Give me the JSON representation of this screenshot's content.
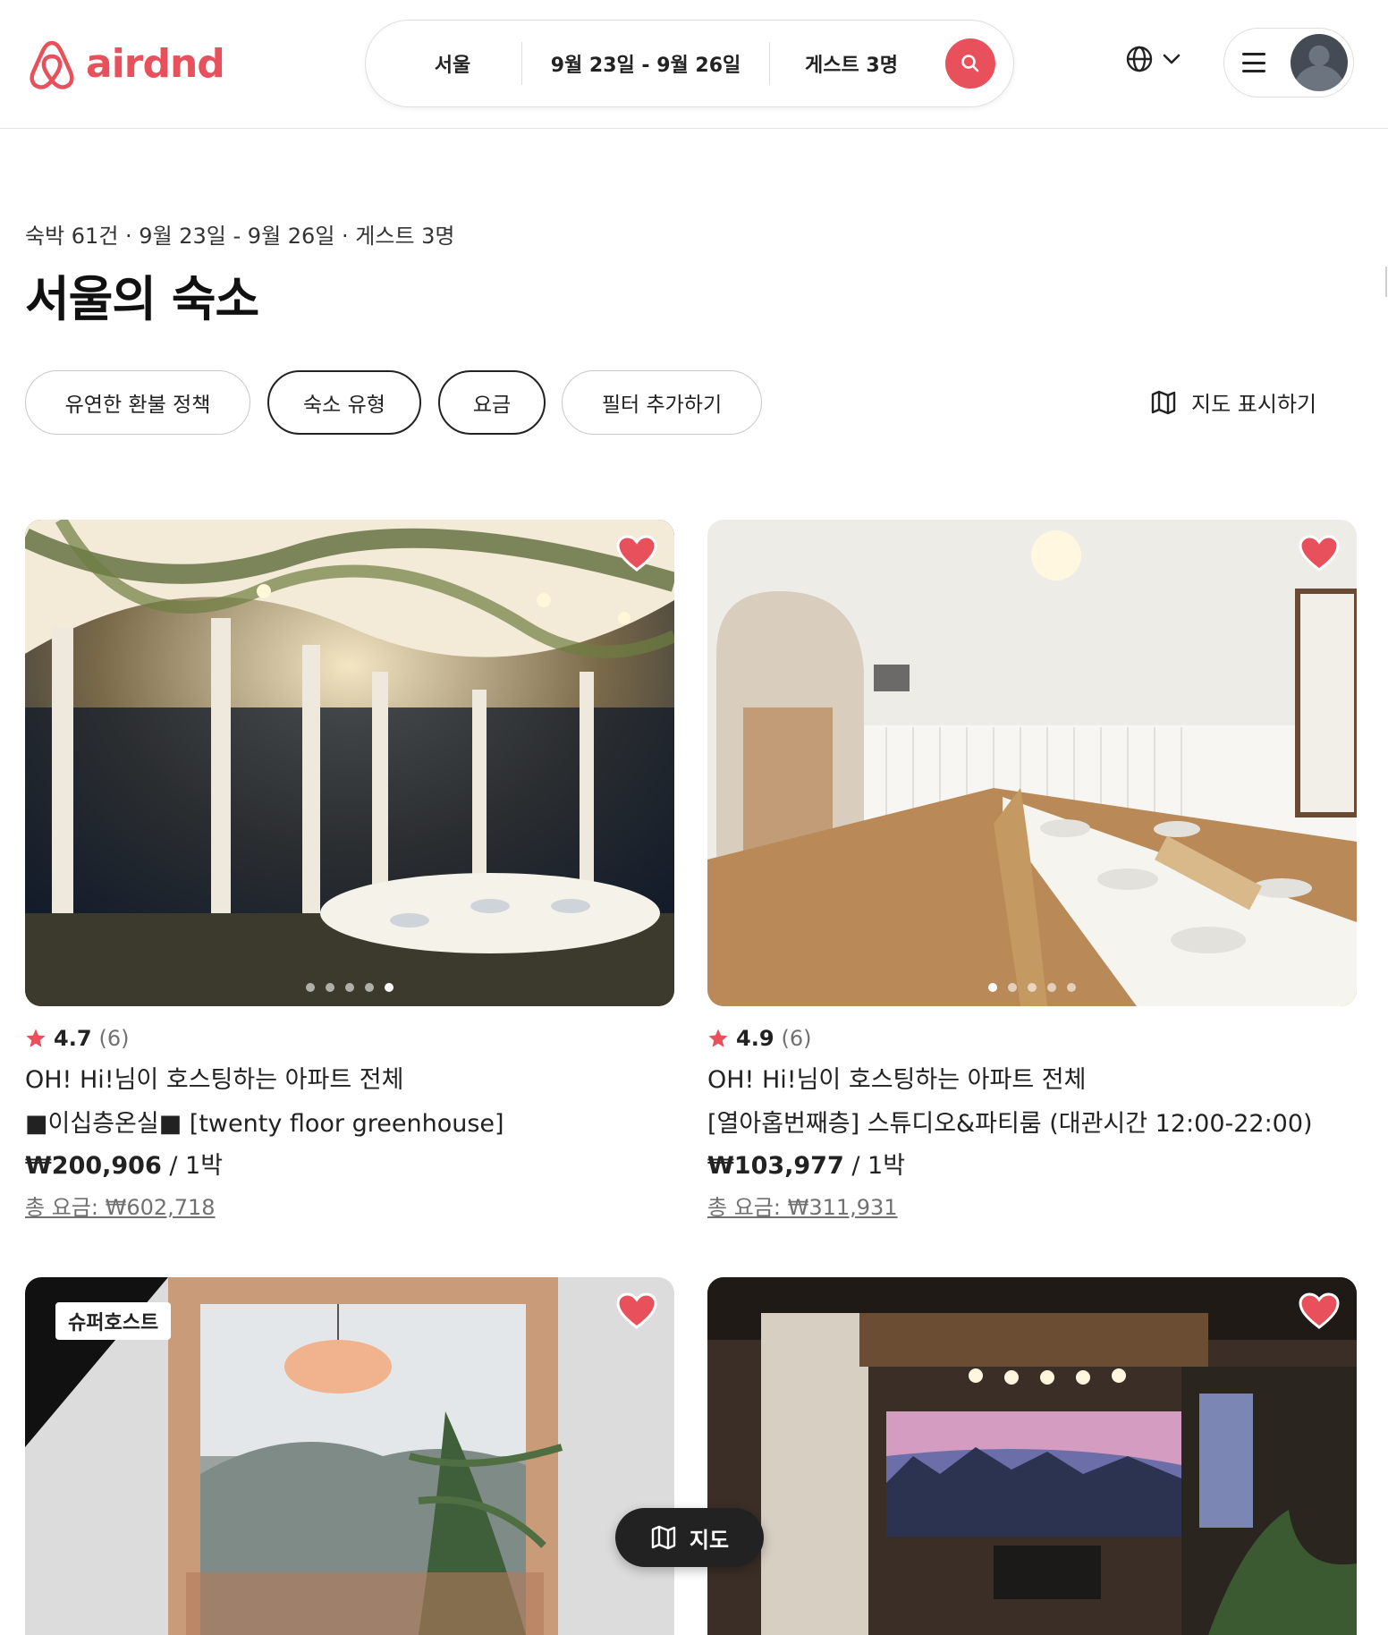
{
  "brand": {
    "name": "airdnd",
    "color": "#e8505b"
  },
  "search": {
    "location": "서울",
    "dates": "9월 23일 - 9월 26일",
    "guests": "게스트 3명",
    "icon": "search-icon"
  },
  "header": {
    "globe_icon": "globe-icon",
    "chevron_icon": "chevron-down-icon",
    "menu_icon": "hamburger-icon"
  },
  "results": {
    "summary": "숙박 61건 · 9월 23일 - 9월 26일 · 게스트 3명",
    "title": "서울의 숙소"
  },
  "filters": {
    "chips": [
      "유연한 환불 정책",
      "숙소 유형",
      "요금",
      "필터 추가하기"
    ],
    "map_toggle": "지도 표시하기"
  },
  "listings": [
    {
      "rating": "4.7",
      "reviews": "(6)",
      "host_line": "OH! Hi!님이 호스팅하는 아파트 전체",
      "name": "■이십층온실■ [twenty floor greenhouse]",
      "price": "₩200,906",
      "per": " / 1박",
      "total": "총 요금: ₩602,718",
      "photo_dots": 5,
      "active_dot": 4
    },
    {
      "rating": "4.9",
      "reviews": "(6)",
      "host_line": "OH! Hi!님이 호스팅하는 아파트 전체",
      "name": "[열아홉번째층] 스튜디오&파티룸 (대관시간 12:00-22:00)",
      "price": "₩103,977",
      "per": " / 1박",
      "total": "총 요금: ₩311,931",
      "photo_dots": 5,
      "active_dot": 0
    },
    {
      "badge": "슈퍼호스트"
    },
    {}
  ],
  "floating_map_button": {
    "label": "지도",
    "icon": "map-icon"
  },
  "colors": {
    "accent": "#e8505b",
    "star": "#e8505b",
    "text": "#222222",
    "muted": "#717171"
  }
}
